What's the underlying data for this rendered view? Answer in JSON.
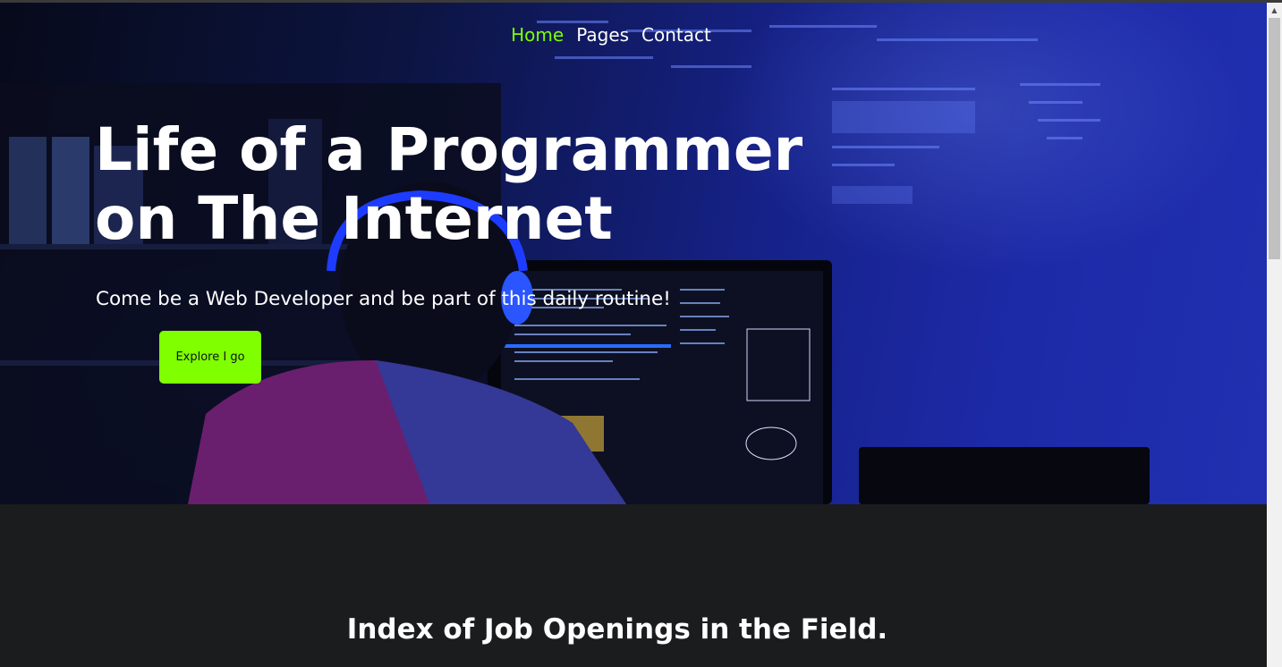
{
  "nav": {
    "items": [
      {
        "label": "Home",
        "active": true
      },
      {
        "label": "Pages",
        "active": false
      },
      {
        "label": "Contact",
        "active": false
      }
    ]
  },
  "hero": {
    "title_line1": "Life of a Programmer",
    "title_line2": "on The Internet",
    "subtitle": "Come be a Web Developer and be part of this daily routine!",
    "cta_label": "Explore I go"
  },
  "section": {
    "title": "Index of Job Openings in the Field."
  },
  "colors": {
    "accent": "#7fff00",
    "dark_background": "#1b1c1e",
    "hero_blue": "#1d2aa8"
  },
  "scrollbar": {
    "up_icon": "triangle-up-icon"
  }
}
